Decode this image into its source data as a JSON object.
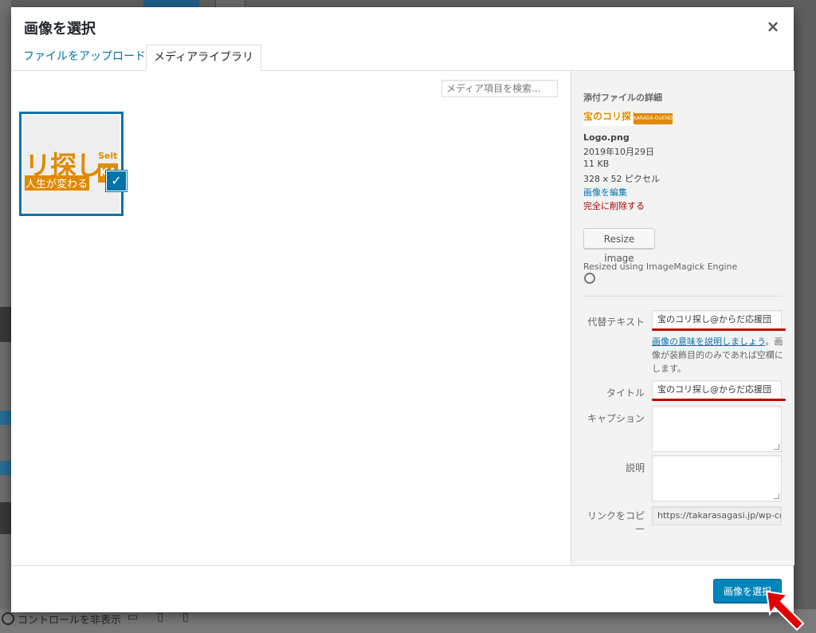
{
  "modal": {
    "title": "画像を選択",
    "close_icon": "×"
  },
  "tabs": [
    {
      "label": "ファイルをアップロード",
      "active": false
    },
    {
      "label": "メディアライブラリ",
      "active": true
    }
  ],
  "search": {
    "placeholder": "メディア項目を検索..."
  },
  "thumbnail": {
    "text_main": "リ探し",
    "text_sub": "人生が変わる",
    "text_brand": "Seita",
    "text_brand2": "KARA",
    "checked": true
  },
  "attachment": {
    "heading": "添付ファイルの詳細",
    "logo_text_left": "宝のコリ探し",
    "logo_text_right": "KARADA-OUENDAN",
    "filename": "Logo.png",
    "date": "2019年10月29日",
    "filesize": "11 KB",
    "dimensions": "328 x 52 ピクセル",
    "edit_link": "画像を編集",
    "delete_link": "完全に削除する",
    "resize_button": "Resize image",
    "resized_note": "Resized using ImageMagick Engine"
  },
  "fields": {
    "alt_label": "代替テキスト",
    "alt_value": "宝のコリ探し@からだ応援団",
    "alt_help_link": "画像の意味を説明しましょう",
    "alt_help_text": "。画像が装飾目的のみであれば空欄にします。",
    "title_label": "タイトル",
    "title_value": "宝のコリ探し@からだ応援団",
    "caption_label": "キャプション",
    "caption_value": "",
    "description_label": "説明",
    "description_value": "",
    "copy_link_label": "リンクをコピー",
    "copy_link_value": "https://takarasagasi.jp/wp-co"
  },
  "toolbar": {
    "select_button": "画像を選択"
  },
  "background": {
    "bottom_text": "コントロールを非表示"
  },
  "colors": {
    "accent": "#0073aa",
    "primary_button": "#0085ba",
    "delete": "#aa0000",
    "annotation": "#c00000",
    "logo_orange": "#e08a00"
  }
}
